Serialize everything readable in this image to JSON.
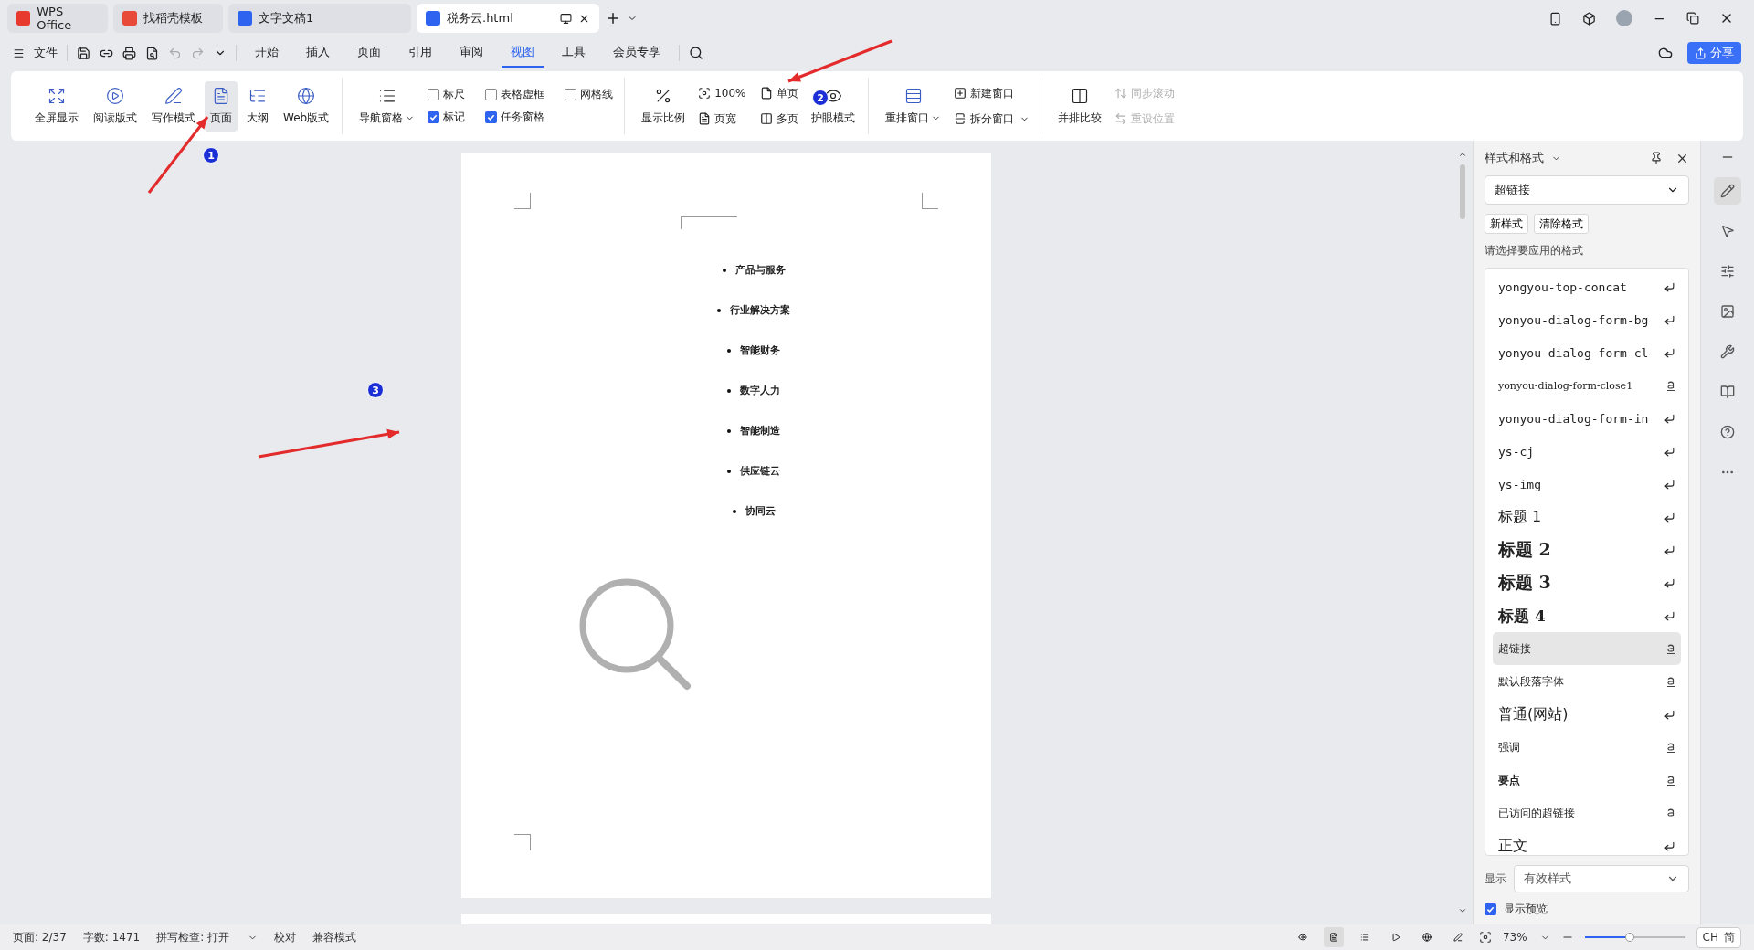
{
  "doc_tabs": [
    {
      "label": "WPS Office",
      "kind": "home",
      "selected": false
    },
    {
      "label": "找稻壳模板",
      "kind": "template",
      "selected": false
    },
    {
      "label": "文字文稿1",
      "kind": "doc",
      "selected": false
    },
    {
      "label": "税务云.html",
      "kind": "doc",
      "selected": true
    }
  ],
  "menu": {
    "file": "文件",
    "tabs": [
      {
        "label": "开始",
        "selected": false
      },
      {
        "label": "插入",
        "selected": false
      },
      {
        "label": "页面",
        "selected": false
      },
      {
        "label": "引用",
        "selected": false
      },
      {
        "label": "审阅",
        "selected": false
      },
      {
        "label": "视图",
        "selected": true
      },
      {
        "label": "工具",
        "selected": false
      },
      {
        "label": "会员专享",
        "selected": false
      }
    ],
    "share": "分享"
  },
  "ribbon": {
    "views": [
      {
        "label": "全屏显示",
        "selected": false
      },
      {
        "label": "阅读版式",
        "selected": false
      },
      {
        "label": "写作模式",
        "selected": false
      },
      {
        "label": "页面",
        "selected": true
      },
      {
        "label": "大纲",
        "selected": false
      },
      {
        "label": "Web版式",
        "selected": false
      }
    ],
    "nav_pane": "导航窗格",
    "checks": [
      {
        "label": "标尺",
        "checked": false
      },
      {
        "label": "表格虚框",
        "checked": false
      },
      {
        "label": "网格线",
        "checked": false
      },
      {
        "label": "标记",
        "checked": true
      },
      {
        "label": "任务窗格",
        "checked": true
      }
    ],
    "zoom": "显示比例",
    "zoom_small": [
      "100%",
      "页宽",
      "单页",
      "多页"
    ],
    "eye_mode": "护眼模式",
    "rearrange": "重排窗口",
    "new_window": "新建窗口",
    "split_window": "拆分窗口",
    "compare": "并排比较",
    "sync_scroll": {
      "label": "同步滚动",
      "disabled": true
    },
    "reset_pos": {
      "label": "重设位置",
      "disabled": true
    }
  },
  "document": {
    "bullets": [
      "产品与服务",
      "行业解决方案",
      "智能财务",
      "数字人力",
      "智能制造",
      "供应链云",
      "协同云"
    ]
  },
  "annotations": [
    {
      "number": "1"
    },
    {
      "number": "2"
    },
    {
      "number": "3"
    }
  ],
  "styles_panel": {
    "title": "样式和格式",
    "current": "超链接",
    "new_style": "新样式",
    "clear_format": "清除格式",
    "prompt": "请选择要应用的格式",
    "items": [
      {
        "name": "yongyou-top-concat",
        "kind": "paragraph",
        "selected": false
      },
      {
        "name": "yonyou-dialog-form-bg",
        "kind": "paragraph",
        "selected": false
      },
      {
        "name": "yonyou-dialog-form-cl",
        "kind": "paragraph",
        "selected": false
      },
      {
        "name": "yonyou-dialog-form-close1",
        "kind": "character",
        "selected": false
      },
      {
        "name": "yonyou-dialog-form-in",
        "kind": "paragraph",
        "selected": false
      },
      {
        "name": "ys-cj",
        "kind": "paragraph",
        "selected": false
      },
      {
        "name": "ys-img",
        "kind": "paragraph",
        "selected": false
      },
      {
        "name": "标题 1",
        "kind": "paragraph",
        "selected": false
      },
      {
        "name": "标题 2",
        "kind": "paragraph",
        "selected": false
      },
      {
        "name": "标题 3",
        "kind": "paragraph",
        "selected": false
      },
      {
        "name": "标题 4",
        "kind": "paragraph",
        "selected": false
      },
      {
        "name": "超链接",
        "kind": "character",
        "selected": true
      },
      {
        "name": "默认段落字体",
        "kind": "character",
        "selected": false
      },
      {
        "name": "普通(网站)",
        "kind": "paragraph",
        "selected": false
      },
      {
        "name": "强调",
        "kind": "character",
        "selected": false
      },
      {
        "name": "要点",
        "kind": "character",
        "selected": false
      },
      {
        "name": "已访问的超链接",
        "kind": "character",
        "selected": false
      },
      {
        "name": "正文",
        "kind": "paragraph",
        "selected": false
      }
    ],
    "show_label": "显示",
    "show_value": "有效样式",
    "preview": {
      "label": "显示预览",
      "checked": true
    }
  },
  "side_tools": [
    {
      "selected": true
    },
    {
      "selected": false
    },
    {
      "selected": false
    },
    {
      "selected": false
    },
    {
      "selected": false
    },
    {
      "selected": false
    },
    {
      "selected": false
    },
    {
      "selected": false
    }
  ],
  "status": {
    "page": "页面: 2/37",
    "words": "字数: 1471",
    "spell": "拼写检查: 打开",
    "proof": "校对",
    "compat": "兼容模式",
    "view_modes": [
      {
        "selected": false
      },
      {
        "selected": true
      },
      {
        "selected": false
      },
      {
        "selected": false
      },
      {
        "selected": false
      },
      {
        "selected": false
      }
    ],
    "zoom": "73%",
    "zoom_slider": {
      "level": 0.45
    },
    "ime": [
      "CH",
      "简"
    ]
  }
}
